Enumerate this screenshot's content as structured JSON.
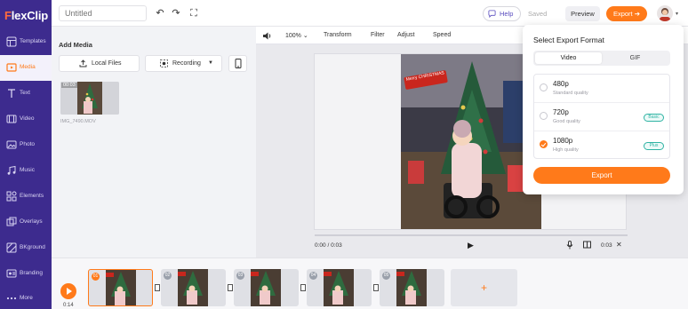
{
  "app": {
    "logo": "FlexClip"
  },
  "sidebar": {
    "items": [
      {
        "label": "Templates",
        "icon": "templates-icon"
      },
      {
        "label": "Media",
        "icon": "media-icon",
        "active": true
      },
      {
        "label": "Text",
        "icon": "text-icon"
      },
      {
        "label": "Video",
        "icon": "video-icon"
      },
      {
        "label": "Photo",
        "icon": "photo-icon"
      },
      {
        "label": "Music",
        "icon": "music-icon"
      },
      {
        "label": "Elements",
        "icon": "elements-icon"
      },
      {
        "label": "Overlays",
        "icon": "overlays-icon"
      },
      {
        "label": "BKground",
        "icon": "background-icon"
      },
      {
        "label": "Branding",
        "icon": "branding-icon"
      },
      {
        "label": "More",
        "icon": "more-icon"
      }
    ]
  },
  "topbar": {
    "title_placeholder": "Untitled",
    "help": "Help",
    "saved": "Saved",
    "preview": "Preview",
    "export": "Export"
  },
  "media": {
    "heading": "Add Media",
    "local_files": "Local Files",
    "recording": "Recording",
    "thumb_duration": "00:03",
    "thumb_name": "IMG_7490.MOV"
  },
  "toolbar": {
    "zoom": "100%",
    "transform": "Transform",
    "filter": "Filter",
    "adjust": "Adjust",
    "speed": "Speed"
  },
  "player": {
    "current_time": "0:00 / 0:03",
    "duration": "0:03"
  },
  "video_overlay": {
    "sticker_text": "Merry CHRISTMAS"
  },
  "timeline": {
    "time": "0:14",
    "clips": [
      "01",
      "02",
      "03",
      "04",
      "05"
    ],
    "add_clip": "+"
  },
  "export_panel": {
    "title": "Select Export Format",
    "tabs": [
      "Video",
      "GIF"
    ],
    "selected_tab": "Video",
    "options": [
      {
        "res": "480p",
        "desc": "Standard quality",
        "badge": "",
        "selected": false
      },
      {
        "res": "720p",
        "desc": "Good quality",
        "badge": "Basic",
        "selected": false
      },
      {
        "res": "1080p",
        "desc": "High quality",
        "badge": "Plus",
        "selected": true
      }
    ],
    "export_button": "Export"
  },
  "colors": {
    "sidebar": "#3d2b8e",
    "accent": "#ff7a1a",
    "badge": "#2fb3a3"
  }
}
